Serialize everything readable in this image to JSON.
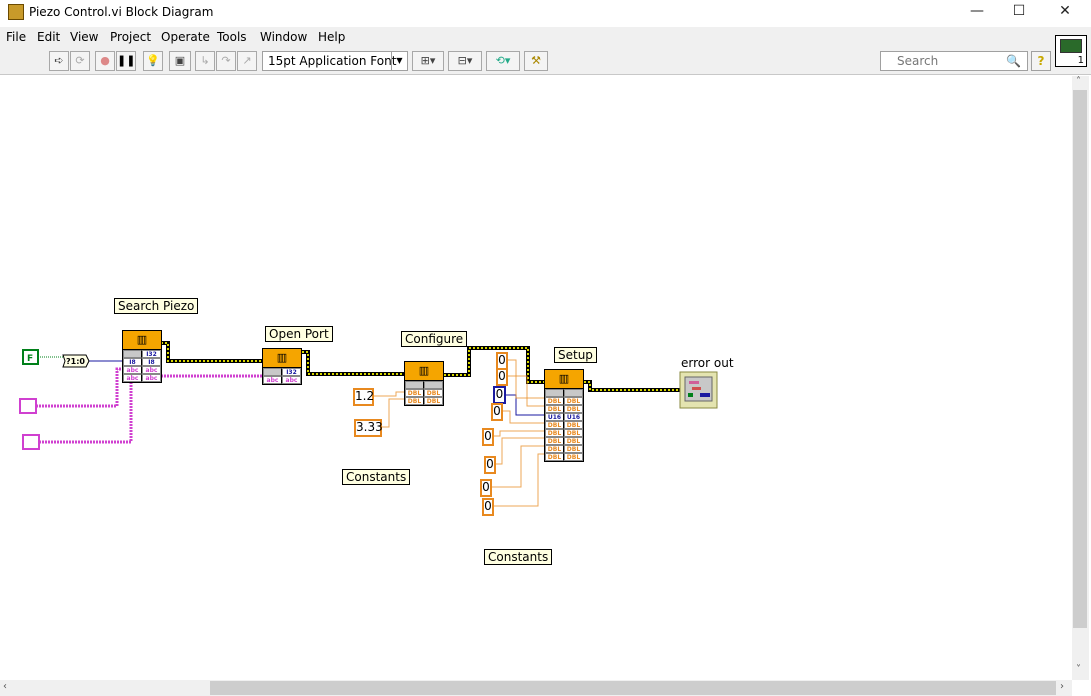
{
  "window": {
    "title": "Piezo Control.vi Block Diagram",
    "minimize": "—",
    "maximize": "☐",
    "close": "✕"
  },
  "menu": [
    "File",
    "Edit",
    "View",
    "Project",
    "Operate",
    "Tools",
    "Window",
    "Help"
  ],
  "toolbar": {
    "font": "15pt Application Font",
    "search_placeholder": "Search",
    "help": "?"
  },
  "diagram": {
    "subvis": [
      {
        "label": "Search Piezo"
      },
      {
        "label": "Open Port"
      },
      {
        "label": "Configure"
      },
      {
        "label": "Setup"
      }
    ],
    "boolean_constant": "F",
    "conversion": "?1:0",
    "comments": [
      "Constants",
      "Constants"
    ],
    "configure_constants": [
      "1.2",
      "3.33"
    ],
    "setup_constants": [
      "0",
      "0",
      "0",
      "0",
      "0",
      "0",
      "0",
      "0"
    ],
    "indicator": {
      "label": "error out"
    }
  },
  "colors": {
    "error_wire": "#c8c800",
    "string_wire": "#d040d0",
    "numeric_wire": "#e8891f",
    "integer_wire": "#1a1aa0",
    "boolean": "#00801a",
    "subvi": "#f5a500"
  }
}
